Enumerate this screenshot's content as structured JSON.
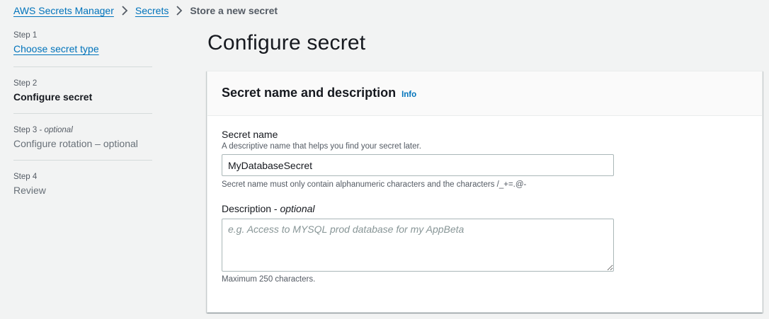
{
  "breadcrumb": {
    "items": [
      {
        "label": "AWS Secrets Manager"
      },
      {
        "label": "Secrets"
      }
    ],
    "current": "Store a new secret"
  },
  "steps": [
    {
      "label": "Step 1",
      "optional": "",
      "title": "Choose secret type",
      "state": "link"
    },
    {
      "label": "Step 2",
      "optional": "",
      "title": "Configure secret",
      "state": "active"
    },
    {
      "label": "Step 3 - ",
      "optional": "optional",
      "title": "Configure rotation – optional",
      "state": "inactive"
    },
    {
      "label": "Step 4",
      "optional": "",
      "title": "Review",
      "state": "inactive"
    }
  ],
  "page_title": "Configure secret",
  "panel": {
    "title": "Secret name and description",
    "info": "Info",
    "secret_name": {
      "label": "Secret name",
      "description": "A descriptive name that helps you find your secret later.",
      "value": "MyDatabaseSecret",
      "constraint": "Secret name must only contain alphanumeric characters and the characters /_+=.@-"
    },
    "description_field": {
      "label": "Description - ",
      "label_optional": "optional",
      "placeholder": "e.g. Access to MYSQL prod database for my AppBeta",
      "constraint": "Maximum 250 characters."
    }
  },
  "colors": {
    "link": "#0073bb",
    "background": "#f2f3f3",
    "text": "#16191f"
  }
}
